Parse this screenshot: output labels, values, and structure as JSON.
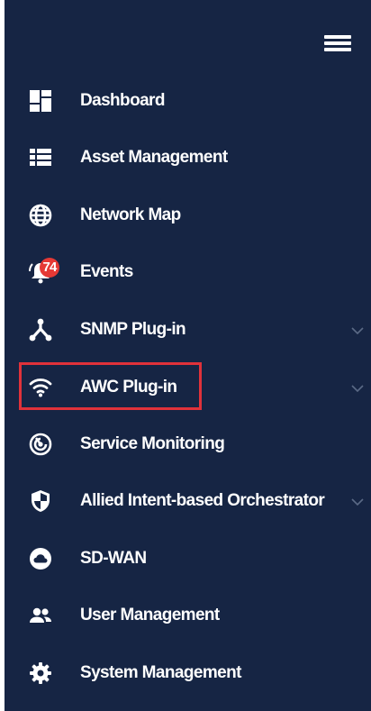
{
  "menu": {
    "toggle_icon": "hamburger-menu-icon"
  },
  "nav": {
    "items": [
      {
        "label": "Dashboard",
        "icon": "dashboard-icon",
        "has_submenu": false
      },
      {
        "label": "Asset Management",
        "icon": "list-icon",
        "has_submenu": false
      },
      {
        "label": "Network Map",
        "icon": "globe-icon",
        "has_submenu": false
      },
      {
        "label": "Events",
        "icon": "alarm-bell-icon",
        "badge": "74",
        "has_submenu": false
      },
      {
        "label": "SNMP Plug-in",
        "icon": "network-hub-icon",
        "has_submenu": true
      },
      {
        "label": "AWC Plug-in",
        "icon": "wifi-icon",
        "has_submenu": true,
        "highlighted": true
      },
      {
        "label": "Service Monitoring",
        "icon": "radar-icon",
        "has_submenu": false
      },
      {
        "label": "Allied Intent-based Orchestrator",
        "icon": "shield-icon",
        "has_submenu": true
      },
      {
        "label": "SD-WAN",
        "icon": "cloud-icon",
        "has_submenu": false
      },
      {
        "label": "User Management",
        "icon": "users-icon",
        "has_submenu": false
      },
      {
        "label": "System Management",
        "icon": "gear-icon",
        "has_submenu": false
      }
    ]
  },
  "colors": {
    "sidebar_background": "#162544",
    "text": "#ffffff",
    "badge": "#e53935",
    "highlight_border": "#e0323a",
    "chevron": "#5b6a86"
  }
}
